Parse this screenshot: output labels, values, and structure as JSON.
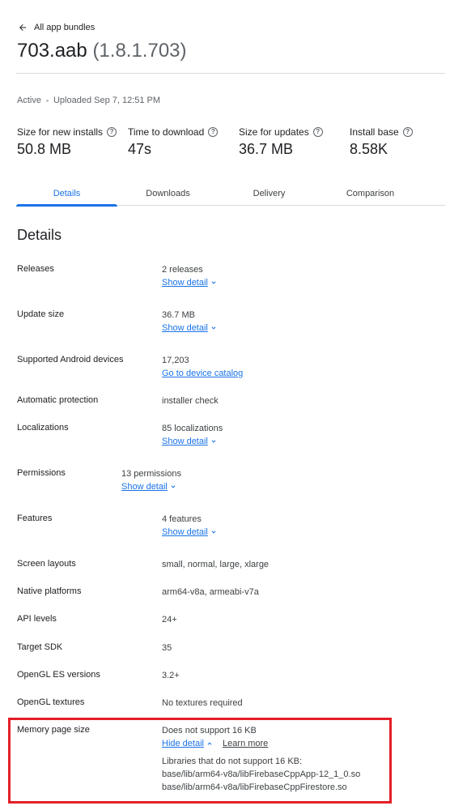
{
  "nav": {
    "back_label": "All app bundles"
  },
  "header": {
    "file_name": "703.aab",
    "version": "(1.8.1.703)"
  },
  "status": {
    "state": "Active",
    "uploaded": "Uploaded Sep 7, 12:51 PM"
  },
  "stats": [
    {
      "label": "Size for new installs",
      "value": "50.8 MB"
    },
    {
      "label": "Time to download",
      "value": "47s"
    },
    {
      "label": "Size for updates",
      "value": "36.7 MB"
    },
    {
      "label": "Install base",
      "value": "8.58K"
    }
  ],
  "tabs": [
    "Details",
    "Downloads",
    "Delivery",
    "Comparison"
  ],
  "active_tab": "Details",
  "details": {
    "title": "Details",
    "rows": [
      {
        "label": "Releases",
        "value": "2 releases",
        "link": "Show detail"
      },
      {
        "label": "Update size",
        "value": "36.7 MB",
        "link": "Show detail"
      },
      {
        "label": "Supported Android devices",
        "value": "17,203",
        "link": "Go to device catalog"
      },
      {
        "label": "Automatic protection",
        "value": "installer check"
      },
      {
        "label": "Localizations",
        "value": "85 localizations",
        "link": "Show detail"
      },
      {
        "label": "Permissions",
        "value": "13 permissions",
        "link": "Show detail"
      },
      {
        "label": "Features",
        "value": "4 features",
        "link": "Show detail"
      },
      {
        "label": "Screen layouts",
        "value": "small, normal, large, xlarge"
      },
      {
        "label": "Native platforms",
        "value": "arm64-v8a, armeabi-v7a"
      },
      {
        "label": "API levels",
        "value": "24+"
      },
      {
        "label": "Target SDK",
        "value": "35"
      },
      {
        "label": "OpenGL ES versions",
        "value": "3.2+"
      },
      {
        "label": "OpenGL textures",
        "value": "No textures required"
      }
    ],
    "memory": {
      "label": "Memory page size",
      "value": "Does not support 16 KB",
      "hide_link": "Hide detail",
      "learn_more": "Learn more",
      "libs_heading": "Libraries that do not support 16 KB:",
      "libs": [
        "base/lib/arm64-v8a/libFirebaseCppApp-12_1_0.so",
        "base/lib/arm64-v8a/libFirebaseCppFirestore.so"
      ]
    }
  },
  "colors": {
    "accent": "#1a73e8",
    "highlight": "#e41e26",
    "divider": "#dadce0"
  }
}
